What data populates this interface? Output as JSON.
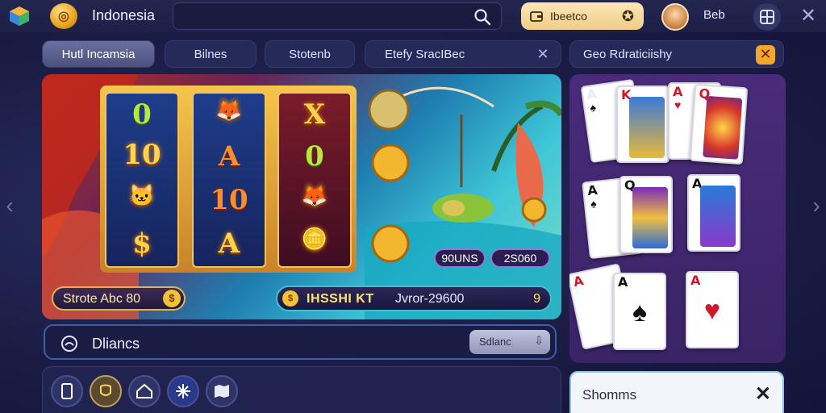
{
  "header": {
    "region": "Indonesia",
    "search_placeholder": "",
    "account_label": "Ibeetco",
    "username": "Beb"
  },
  "tabs": [
    {
      "label": "Hutl Incamsia",
      "active": true
    },
    {
      "label": "Bilnes"
    },
    {
      "label": "Stotenb"
    },
    {
      "label": "Etefy SracIBec",
      "close": "✕"
    },
    {
      "label": "Geo Rdraticiishy",
      "close": "✕"
    }
  ],
  "hero": {
    "reel_symbols": [
      [
        "0",
        "10",
        "cat",
        "$"
      ],
      [
        "fox",
        "A",
        "10",
        "A"
      ],
      [
        "X",
        "0",
        "fox",
        "coins"
      ]
    ],
    "chip_left": "90UNS",
    "chip_right": "2S060",
    "promo_left": "Strote Abc 80",
    "ticker_title": "IHSSHI KT",
    "ticker_value": "Jvror-29600",
    "ticker_count": "9"
  },
  "search_bar": {
    "label": "Dliancs",
    "select_value": "Sdlanc"
  },
  "bottom_icons": [
    "phone-icon",
    "shield-icon",
    "house-icon",
    "sparkle-icon",
    "map-icon"
  ],
  "right_panel": {
    "cards": [
      {
        "rank": "A",
        "suit": "♠",
        "color": "blk"
      },
      {
        "rank": "K",
        "suit": "♥",
        "color": "red"
      },
      {
        "rank": "A",
        "suit": "♥",
        "color": "red"
      },
      {
        "rank": "Q",
        "suit": "♦",
        "color": "red"
      },
      {
        "rank": "A",
        "suit": "♠",
        "color": "blk"
      },
      {
        "rank": "Q",
        "suit": "♠",
        "color": "blk"
      },
      {
        "rank": "A",
        "suit": "♥",
        "color": "red"
      },
      {
        "rank": "A",
        "suit": "♠",
        "color": "blk"
      },
      {
        "rank": "A",
        "suit": "♥",
        "color": "red"
      }
    ]
  },
  "notice": {
    "label": "Shomms",
    "close": "✕"
  },
  "colors": {
    "accent_gold": "#f2c235",
    "background": "#1b1d45",
    "tab_close_orange": "#f4a62a"
  }
}
